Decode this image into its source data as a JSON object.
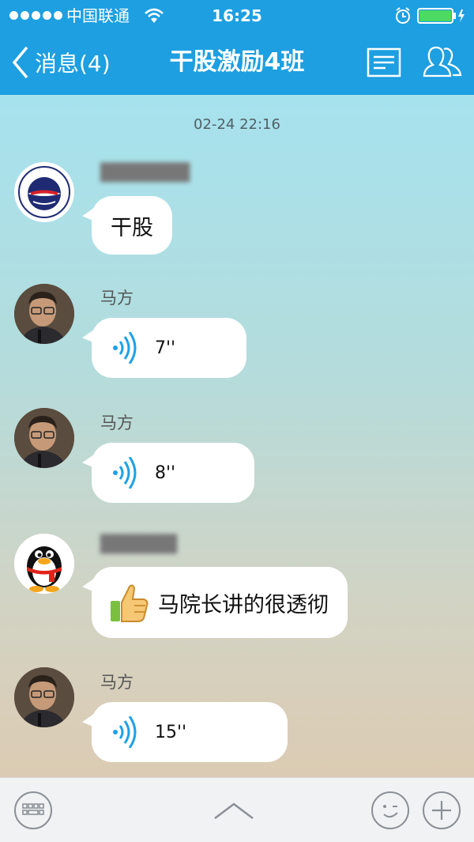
{
  "status_bar": {
    "carrier": "中国联通",
    "time": "16:25"
  },
  "nav": {
    "back_label": "消息(4)",
    "title": "干股激励4班"
  },
  "chat": {
    "timestamp": "02-24 22:16",
    "messages": [
      {
        "sender": "",
        "type": "text",
        "text": "干股"
      },
      {
        "sender": "马方",
        "type": "voice",
        "duration": "7''"
      },
      {
        "sender": "马方",
        "type": "voice",
        "duration": "8''"
      },
      {
        "sender": "",
        "type": "text",
        "emoji": "thumbs-up-icon",
        "text": "马院长讲的很透彻"
      },
      {
        "sender": "马方",
        "type": "voice",
        "duration": "15''"
      }
    ]
  },
  "avatar_logo_text": "SINOTYRE GROUP",
  "colors": {
    "header": "#1d9fe1",
    "voice": "#1ea1e6",
    "battery": "#4cd964"
  }
}
